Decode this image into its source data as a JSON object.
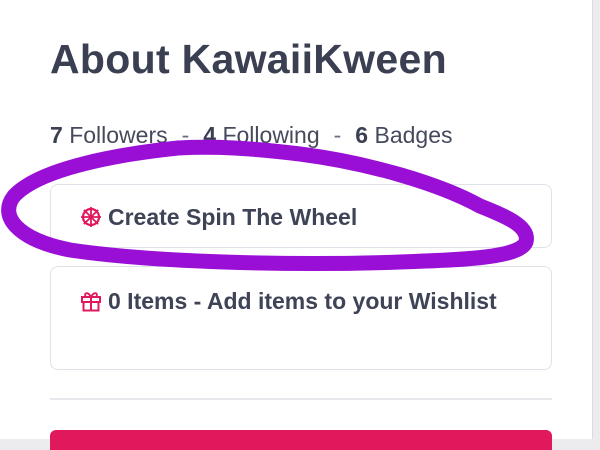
{
  "profile": {
    "title": "About KawaiiKween"
  },
  "stats": {
    "followers_count": "7",
    "followers_label": "Followers",
    "following_count": "4",
    "following_label": "Following",
    "badges_count": "6",
    "badges_label": "Badges",
    "separator": "-"
  },
  "spin_wheel": {
    "label": "Create Spin The Wheel",
    "icon": "wheel-icon"
  },
  "wishlist": {
    "label": "0 Items - Add items to your Wishlist",
    "icon": "gift-icon"
  },
  "colors": {
    "accent": "#e0185c",
    "scribble": "#9a0fd6",
    "text": "#3a3f52"
  }
}
